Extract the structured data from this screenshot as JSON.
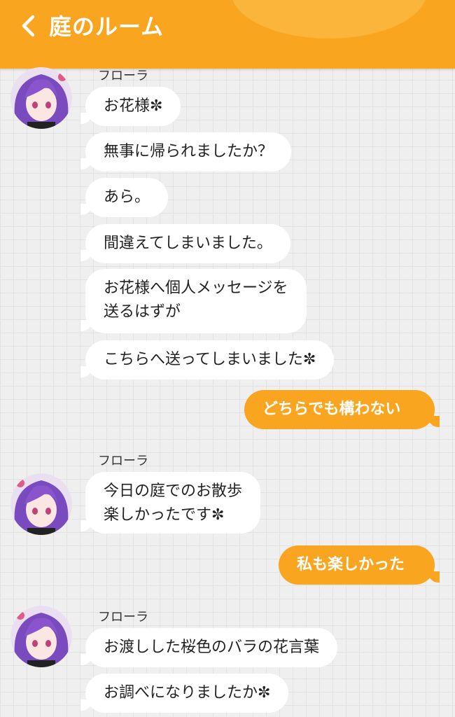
{
  "header": {
    "title": "庭のルーム",
    "back_icon": "chevron-left-icon",
    "color": "#f9a51f"
  },
  "groups": [
    {
      "sender": "フローラ",
      "messages": [
        "お花様✼",
        "無事に帰られましたか？",
        "あら。",
        "間違えてしまいました。",
        "お花様へ個人メッセージを",
        "送るはずが",
        "こちらへ送ってしまいました✼"
      ]
    },
    {
      "self_message": "どちらでも構わない"
    },
    {
      "sender": "フローラ",
      "messages": [
        "今日の庭でのお散歩",
        "楽しかったです✼"
      ]
    },
    {
      "self_message": "私も楽しかった"
    },
    {
      "sender": "フローラ",
      "messages": [
        "お渡しした桜色のバラの花言葉",
        "お調べになりましたか✼"
      ]
    }
  ]
}
